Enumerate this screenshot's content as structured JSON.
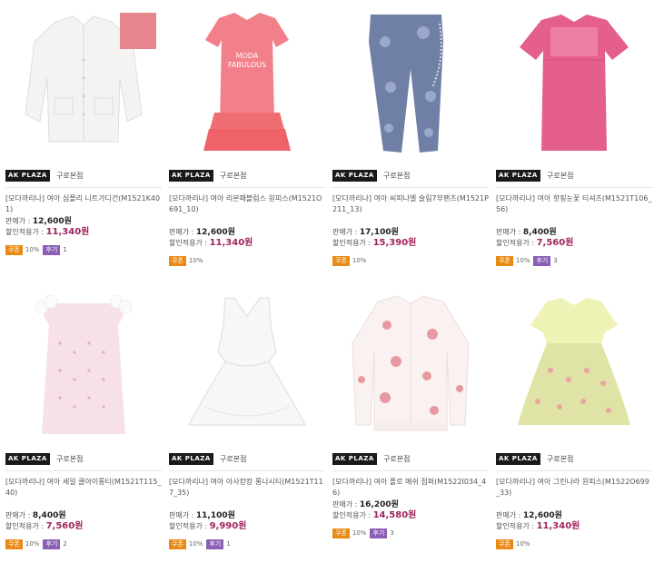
{
  "products": [
    {
      "store": "구로본점",
      "name": "[모다까리나] 여아 심플리 니트가디건(M1521K401)",
      "list_label": "판매가 :",
      "list_price": "12,600원",
      "sale_label": "할인적용가 :",
      "sale_price": "11,340원",
      "coupon": "쿠폰",
      "coupon_pct": "10%",
      "review": "후기",
      "review_count": "1"
    },
    {
      "store": "구로본점",
      "name": "[모다까리나] 여아 리본패블럼스 원피스(M1521O691_10)",
      "list_label": "판매가 :",
      "list_price": "12,600원",
      "sale_label": "할인적용가 :",
      "sale_price": "11,340원",
      "coupon": "쿠폰",
      "coupon_pct": "10%",
      "review": "",
      "review_count": ""
    },
    {
      "store": "구로본점",
      "name": "[모다까리나] 여아 씨피나엘 슬림7부팬츠(M1521P211_13)",
      "list_label": "판매가 :",
      "list_price": "17,100원",
      "sale_label": "할인적용가 :",
      "sale_price": "15,390원",
      "coupon": "쿠폰",
      "coupon_pct": "10%",
      "review": "",
      "review_count": ""
    },
    {
      "store": "구로본점",
      "name": "[모다까리나] 여아 핫핑눈꽃 티셔츠(M1521T106_56)",
      "list_label": "판매가 :",
      "list_price": "8,400원",
      "sale_label": "할인적용가 :",
      "sale_price": "7,560원",
      "coupon": "쿠폰",
      "coupon_pct": "10%",
      "review": "후기",
      "review_count": "3"
    },
    {
      "store": "구로본점",
      "name": "[모다까리나] 여아 세일 클아이롱티(M1521T115_40)",
      "list_label": "판매가 :",
      "list_price": "8,400원",
      "sale_label": "할인적용가 :",
      "sale_price": "7,560원",
      "coupon": "쿠폰",
      "coupon_pct": "10%",
      "review": "후기",
      "review_count": "2"
    },
    {
      "store": "구로본점",
      "name": "[모다까리나] 여아 아사캉캉 롱나시티(M1521T117_35)",
      "list_label": "판매가 :",
      "list_price": "11,100원",
      "sale_label": "할인적용가 :",
      "sale_price": "9,990원",
      "coupon": "쿠폰",
      "coupon_pct": "10%",
      "review": "후기",
      "review_count": "1"
    },
    {
      "store": "구로본점",
      "name": "[모다까리나] 여아 플로 메쉬 점퍼(M1522I034_46)",
      "list_label": "판매가 :",
      "list_price": "16,200원",
      "sale_label": "할인적용가 :",
      "sale_price": "14,580원",
      "coupon": "쿠폰",
      "coupon_pct": "10%",
      "review": "후기",
      "review_count": "3"
    },
    {
      "store": "구로본점",
      "name": "[모다까리나] 여아 그린나라 원피스(M1522O699_33)",
      "list_label": "판매가 :",
      "list_price": "12,600원",
      "sale_label": "할인적용가 :",
      "sale_price": "11,340원",
      "coupon": "쿠폰",
      "coupon_pct": "10%",
      "review": "",
      "review_count": ""
    }
  ],
  "brand_logo": "AK PLAZA",
  "colors": {
    "sale_price": "#a0245e",
    "coupon_badge": "#e98a15",
    "review_badge": "#8a5fb5"
  }
}
